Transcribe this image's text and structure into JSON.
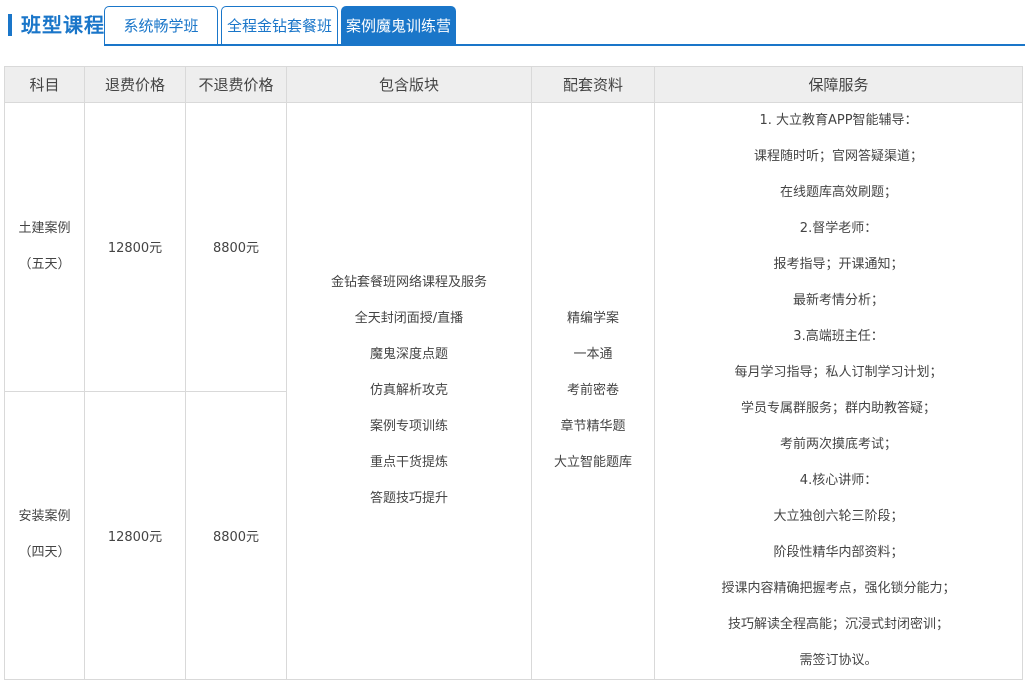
{
  "header": {
    "title": "班型课程",
    "tabs": [
      {
        "label": "系统畅学班",
        "active": false
      },
      {
        "label": "全程金钻套餐班",
        "active": false
      },
      {
        "label": "案例魔鬼训练营",
        "active": true
      }
    ]
  },
  "table": {
    "headers": [
      "科目",
      "退费价格",
      "不退费价格",
      "包含版块",
      "配套资料",
      "保障服务"
    ],
    "rows": [
      {
        "subject_line1": "土建案例",
        "subject_line2": "（五天）",
        "refund_price": "12800元",
        "nonrefund_price": "8800元"
      },
      {
        "subject_line1": "安装案例",
        "subject_line2": "（四天）",
        "refund_price": "12800元",
        "nonrefund_price": "8800元"
      }
    ],
    "modules": [
      "金钻套餐班网络课程及服务",
      "全天封闭面授/直播",
      "魔鬼深度点题",
      "仿真解析攻克",
      "案例专项训练",
      "重点干货提炼",
      "答题技巧提升"
    ],
    "materials": [
      "精编学案",
      "一本通",
      "考前密卷",
      "章节精华题",
      "大立智能题库"
    ],
    "services": [
      "1. 大立教育APP智能辅导：",
      "课程随时听；官网答疑渠道；",
      "在线题库高效刷题；",
      "2.督学老师：",
      "报考指导；开课通知；",
      "最新考情分析；",
      "3.高端班主任：",
      "每月学习指导；私人订制学习计划；",
      "学员专属群服务；群内助教答疑；",
      "考前两次摸底考试；",
      "4.核心讲师：",
      "大立独创六轮三阶段；",
      "阶段性精华内部资料；",
      "授课内容精确把握考点，强化锁分能力；",
      "技巧解读全程高能；沉浸式封闭密训；",
      "需签订协议。"
    ]
  },
  "colors": {
    "accent": "#1a76c9",
    "header_bg": "#eeeeee",
    "border": "#d9d9d9"
  }
}
